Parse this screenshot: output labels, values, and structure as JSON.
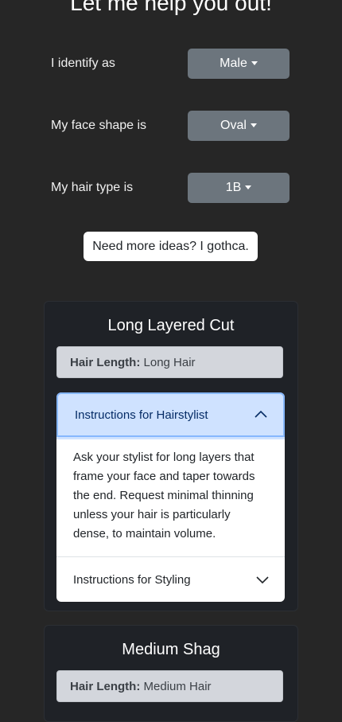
{
  "header": {
    "title": "Let me help you out!"
  },
  "filters": [
    {
      "label": "I identify as",
      "value": "Male"
    },
    {
      "label": "My face shape is",
      "value": "Oval"
    },
    {
      "label": "My hair type is",
      "value": "1B"
    }
  ],
  "ideas_button": "Need more ideas? I gothca.",
  "cards": [
    {
      "title": "Long Layered Cut",
      "hair_length_label": "Hair Length:",
      "hair_length_value": "Long Hair",
      "accordion": [
        {
          "title": "Instructions for Hairstylist",
          "expanded": true,
          "body": "Ask your stylist for long layers that frame your face and taper towards the end. Request minimal thinning unless your hair is particularly dense, to maintain volume."
        },
        {
          "title": "Instructions for Styling",
          "expanded": false
        }
      ]
    },
    {
      "title": "Medium Shag",
      "hair_length_label": "Hair Length:",
      "hair_length_value": "Medium Hair"
    }
  ],
  "colors": {
    "background": "#262626",
    "card": "#1f2227",
    "dropdown": "#6c757d",
    "accordion_active": "#cfe2ff"
  }
}
